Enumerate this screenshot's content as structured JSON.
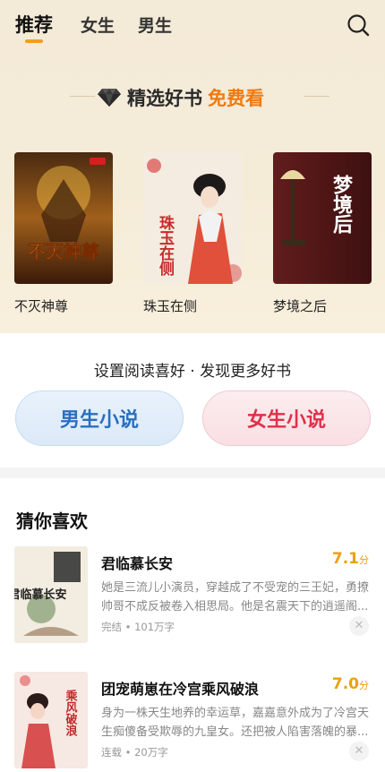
{
  "tabs": [
    {
      "label": "推荐",
      "active": true
    },
    {
      "label": "女生",
      "active": false
    },
    {
      "label": "男生",
      "active": false
    }
  ],
  "featured": {
    "title_prefix": "精选好书",
    "title_highlight": "免费看",
    "icon": "diamond-icon",
    "books": [
      {
        "title": "不灭神尊",
        "cover_text": "不灭神尊"
      },
      {
        "title": "珠玉在侧",
        "cover_text": "珠玉在侧"
      },
      {
        "title": "梦境之后",
        "cover_text": "梦境后"
      }
    ]
  },
  "preference": {
    "title": "设置阅读喜好 · 发现更多好书",
    "male_label": "男生小说",
    "female_label": "女生小说"
  },
  "guess": {
    "title": "猜你喜欢",
    "items": [
      {
        "name": "君临慕长安",
        "score": "7.1",
        "score_unit": "分",
        "desc": "她是三流儿小演员，穿越成了不受宠的三王妃，勇撩帅哥不成反被卷入相思局。他是名震天下的逍遥阁...",
        "meta": "完结 • 101万字",
        "cover_text": "君临慕长安"
      },
      {
        "name": "团宠萌崽在冷宫乘风破浪",
        "score": "7.0",
        "score_unit": "分",
        "desc": "身为一株天生地养的幸运草，嘉嘉意外成为了冷宫天生痴傻备受欺辱的九皇女。还把被人陷害落魄的暴...",
        "meta": "连载 • 20万字",
        "cover_text": "乘风破浪"
      }
    ]
  },
  "colors": {
    "accent": "#f0a020",
    "free_highlight": "#f07a10",
    "male_text": "#2a6fc0",
    "female_text": "#e0304a",
    "score": "#e8a10f"
  }
}
